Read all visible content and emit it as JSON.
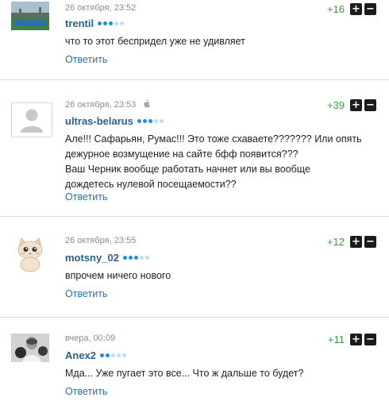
{
  "comments": [
    {
      "date": "26 октября, 23:52",
      "username": "trentil",
      "rating": 3,
      "score": "+16",
      "text": [
        "что то этот беспридел уже не удивляет"
      ],
      "reply_label": "Ответить",
      "avatar": "stadium-photo-avatar"
    },
    {
      "date": "26 октября, 23:53",
      "device_icon": "apple-icon",
      "username": "ultras-belarus",
      "rating": 3,
      "score": "+39",
      "text": [
        "Але!!! Сафарьян, Румас!!! Это тоже схаваете??????? Или опять",
        "дежурное возмущение на сайте бфф появится???",
        "Ваш Черник вообще работать начнет или вы вообще",
        "дождетесь нулевой посещаемости??"
      ],
      "reply_label": "Ответить",
      "avatar": "default-user-avatar"
    },
    {
      "date": "26 октября, 23:55",
      "username": "motsny_02",
      "rating": 3,
      "score": "+12",
      "text": [
        "впрочем ничего нового"
      ],
      "reply_label": "Ответить",
      "avatar": "cat-avatar"
    },
    {
      "date": "вчера, 00:09",
      "username": "Anex2",
      "rating": 2,
      "score": "+11",
      "text": [
        "Мда... Уже пугает это все... Что ж дальше то будет?"
      ],
      "reply_label": "Ответить",
      "avatar": "boxer-photo-avatar"
    }
  ],
  "vote_up_symbol": "+",
  "vote_down_symbol": "−",
  "colors": {
    "username": "#2a5f8f",
    "reply_link": "#2a6fb0",
    "score": "#3c9a3c",
    "rating_dot_on": "#1f8ee0",
    "rating_dot_off": "#bfdcf3",
    "vote_button": "#1b1b1b"
  }
}
